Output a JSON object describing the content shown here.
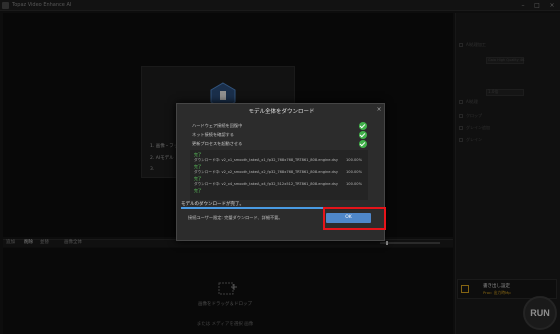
{
  "titlebar": {
    "title": "Topaz Video Enhance AI"
  },
  "preview": {
    "steps": [
      "1. 画像・フッ",
      "2. AIモデル",
      "3. "
    ]
  },
  "bottom": {
    "tabs": [
      "追加",
      "削除",
      "並替",
      "画像全体"
    ],
    "drop_text": "画像をドラッグ＆ドロップ",
    "media_text": "または メディアを選択 画像"
  },
  "right_panel": {
    "rows": [
      "AI処理加工",
      "Gaia High Quality 4K",
      "1.0倍",
      "AI処理",
      "クロップ",
      "グレイン追加",
      "グレイン"
    ]
  },
  "export": {
    "title": "書き出し設定",
    "format": "Proc: 出力時Mp",
    "run_label": "RUN"
  },
  "modal": {
    "title": "モデル全体をダウンロード",
    "close_glyph": "×",
    "checks": [
      "ハードウェア接続を回復中",
      "ネット接続を確認する",
      "更新プロセスを起動させる"
    ],
    "log": [
      {
        "status": "完了",
        "text": "ダウンロード中: v2_x1_smooth_takeA_x1_fp32_768x768_TRT861_808.engine.dsy",
        "pct": "100.00%"
      },
      {
        "status": "完了",
        "text": "ダウンロード中: v2_x2_smooth_takeA_x2_fp32_768x768_TRT861_808.engine.dsy",
        "pct": "100.00%"
      },
      {
        "status": "完了",
        "text": "ダウンロード中: v2_x4_smooth_takeA_x4_fp32_512x512_TRT861_808.engine.dsy",
        "pct": "100.00%"
      },
      {
        "status": "完了",
        "text": "",
        "pct": ""
      }
    ],
    "complete_text": "モデルのダウンロードが完了。",
    "progress": 1.0,
    "notice_text": "接続ユーザー限定: 完璧ダウンロード、詳細不要。",
    "ok_label": "OK"
  },
  "colors": {
    "accent": "#4f87c9",
    "success": "#40b24a",
    "highlight": "#e6141a"
  }
}
